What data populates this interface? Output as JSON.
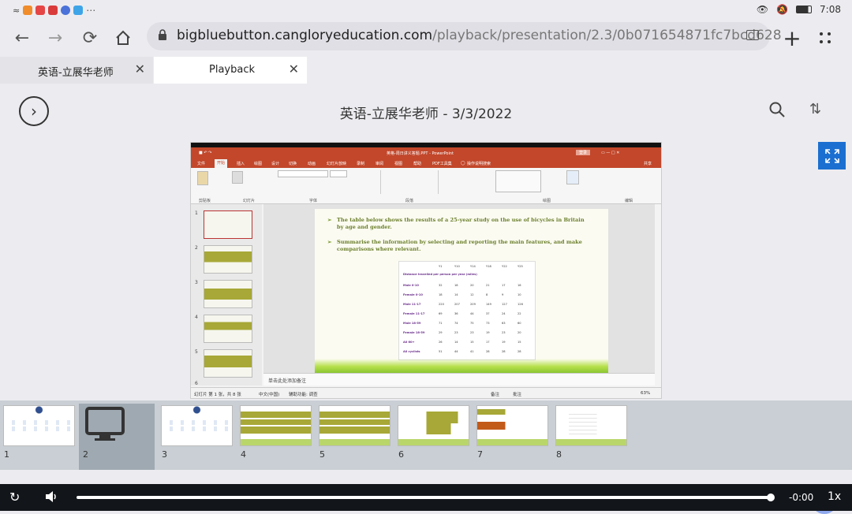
{
  "status_bar": {
    "time": "7:08"
  },
  "browser": {
    "url_host": "bigbluebutton.cangloryeducation.com",
    "url_path": "/playback/presentation/2.3/0b071654871fc7bcd628",
    "tabs": [
      {
        "label": "英语-立展华老师"
      },
      {
        "label": "Playback"
      }
    ]
  },
  "presentation": {
    "title": "英语-立展华老师 - 3/3/2022"
  },
  "slide": {
    "app_title": "英格-周日讲义答题.PPT - PowerPoint",
    "login_label": "登录",
    "share_label": "共享",
    "ribbon_tabs": [
      "文件",
      "开始",
      "插入",
      "绘图",
      "设计",
      "切换",
      "动画",
      "幻灯片放映",
      "录制",
      "审阅",
      "视图",
      "帮助",
      "PDF工具集",
      "操作说明搜索"
    ],
    "ribbon_groups": [
      "剪贴板",
      "幻灯片",
      "字体",
      "段落",
      "绘图",
      "编辑"
    ],
    "bullet_1": "The table below shows the results of a 25-year study on the use of bicycles in Britain by age and gender.",
    "bullet_2": "Summarise the information by selecting and reporting the main features, and make comparisons where relevant.",
    "table_caption": "Distance travelled per person per year (miles)",
    "table_headers": [
      "Y1",
      "Y10",
      "Y14",
      "Y18",
      "Y22",
      "Y25"
    ],
    "table_rows": [
      {
        "label": "Male 0-10",
        "values": [
          "32",
          "18",
          "20",
          "21",
          "17",
          "16"
        ]
      },
      {
        "label": "Female 0-10",
        "values": [
          "18",
          "14",
          "12",
          "8",
          "9",
          "10"
        ]
      },
      {
        "label": "Male 11-17",
        "values": [
          "220",
          "207",
          "209",
          "149",
          "127",
          "126"
        ]
      },
      {
        "label": "Female 11-17",
        "values": [
          "69",
          "36",
          "44",
          "37",
          "24",
          "22"
        ]
      },
      {
        "label": "Male 18-59",
        "values": [
          "71",
          "74",
          "75",
          "73",
          "63",
          "60"
        ]
      },
      {
        "label": "Female 18-59",
        "values": [
          "29",
          "23",
          "23",
          "19",
          "23",
          "20"
        ]
      },
      {
        "label": "All 60+",
        "values": [
          "26",
          "14",
          "15",
          "17",
          "19",
          "15"
        ]
      },
      {
        "label": "All cyclists",
        "values": [
          "51",
          "44",
          "41",
          "28",
          "28",
          "28"
        ]
      }
    ],
    "thumb_numbers": [
      "1",
      "2",
      "3",
      "4",
      "5",
      "6"
    ],
    "notes_placeholder": "单击此处添加备注",
    "status_left": "幻灯片 第 1 张，共 8 张",
    "status_lang": "中文(中国)",
    "status_access": "辅助功能: 调查",
    "status_notes": "备注",
    "status_comments": "批注",
    "zoom": "63%"
  },
  "thumbnails": [
    {
      "num": "1"
    },
    {
      "num": "2"
    },
    {
      "num": "3"
    },
    {
      "num": "4"
    },
    {
      "num": "5"
    },
    {
      "num": "6"
    },
    {
      "num": "7"
    },
    {
      "num": "8"
    }
  ],
  "player": {
    "time": "-0:00",
    "speed": "1x",
    "progress": 1.0
  },
  "colors": {
    "accent_blue": "#1b6fd0",
    "powerpoint_red": "#c2472b",
    "slide_green": "#6b7f2c",
    "grid_button": "#8fa8ee"
  }
}
